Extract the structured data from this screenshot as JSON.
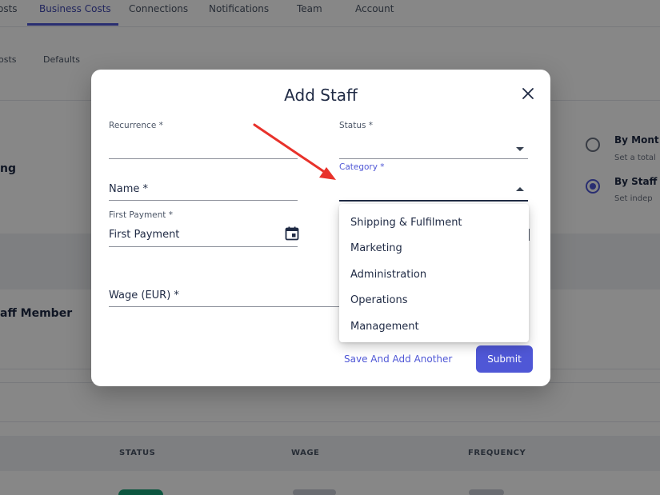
{
  "top_nav": {
    "tabs": [
      {
        "label": "osts"
      },
      {
        "label": "Business Costs",
        "active": true
      },
      {
        "label": "Connections"
      },
      {
        "label": "Notifications"
      },
      {
        "label": "Team"
      },
      {
        "label": "Account"
      }
    ]
  },
  "sub_nav": {
    "tabs": [
      {
        "label": "osts"
      },
      {
        "label": "Defaults"
      }
    ]
  },
  "background": {
    "left_label": "ng",
    "options": [
      {
        "title": "By Mont",
        "description": "Set a total",
        "selected": false
      },
      {
        "title": "By Staff",
        "description": "Set indep",
        "selected": true
      }
    ],
    "section_title": "aff Member",
    "table_headers": [
      "STATUS",
      "WAGE",
      "FREQUENCY"
    ]
  },
  "modal": {
    "title": "Add Staff",
    "fields": {
      "recurrence": {
        "label": "Recurrence *",
        "value": ""
      },
      "status": {
        "label": "Status *",
        "value": ""
      },
      "category": {
        "label": "Category *",
        "value": ""
      },
      "name": {
        "placeholder": "Name *"
      },
      "first_payment": {
        "label": "First Payment *",
        "placeholder": "First Payment"
      },
      "wage": {
        "placeholder": "Wage (EUR) *"
      }
    },
    "category_options": [
      "Shipping & Fulfilment",
      "Marketing",
      "Administration",
      "Operations",
      "Management"
    ],
    "buttons": {
      "save_and_add_another": "Save And Add Another",
      "submit": "Submit"
    }
  },
  "colors": {
    "accent": "#4f57d6",
    "text_dark": "#1f2a44",
    "overlay": "rgba(0,0,0,0.47)",
    "annotation_arrow": "#e8322b",
    "status_green": "#1aa37a"
  }
}
